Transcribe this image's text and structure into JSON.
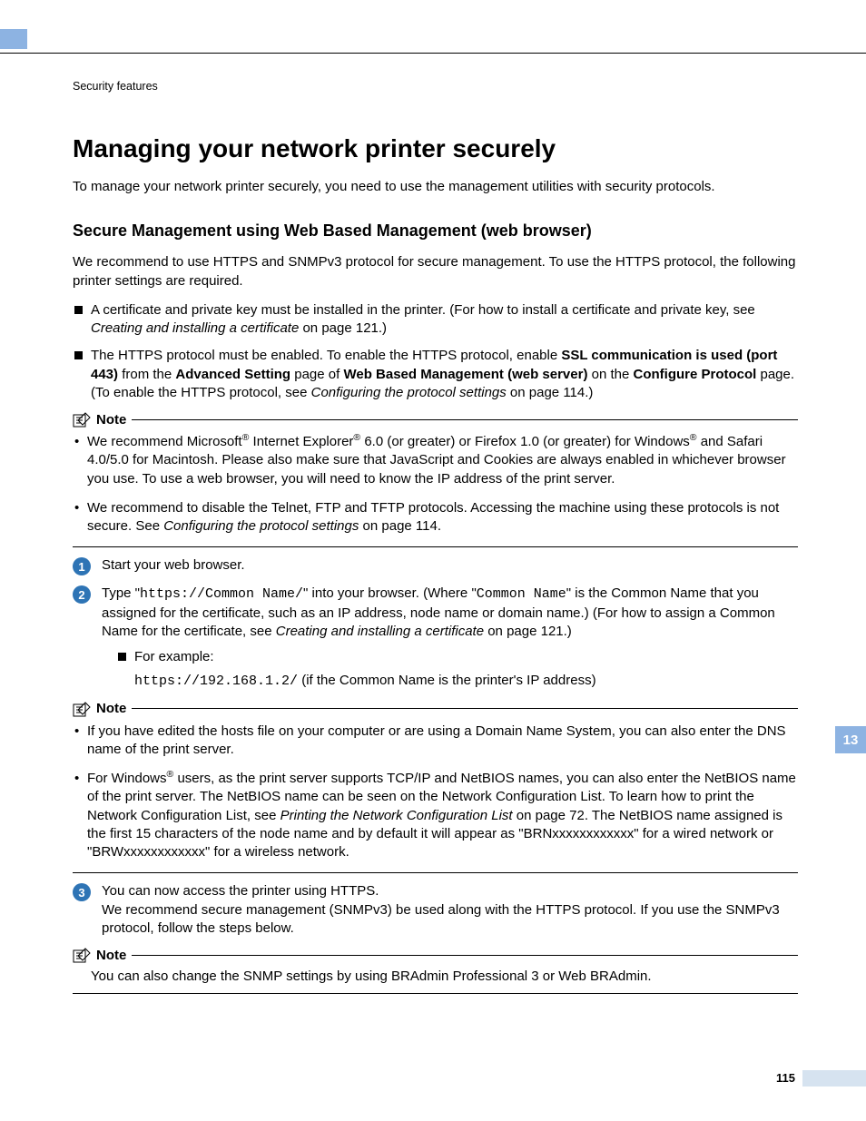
{
  "breadcrumb": "Security features",
  "h1": "Managing your network printer securely",
  "intro": "To manage your network printer securely, you need to use the management utilities with security protocols.",
  "h2": "Secure Management using Web Based Management (web browser)",
  "p1": "We recommend to use HTTPS and SNMPv3 protocol for secure management. To use the HTTPS protocol, the following printer settings are required.",
  "bullet1_a": "A certificate and private key must be installed in the printer. (For how to install a certificate and private key, see ",
  "bullet1_link": "Creating and installing a certificate",
  "bullet1_b": " on page 121.)",
  "bullet2_a": "The HTTPS protocol must be enabled. To enable the HTTPS protocol, enable ",
  "bullet2_b": "SSL communication is used (port 443)",
  "bullet2_c": " from the ",
  "bullet2_d": "Advanced Setting",
  "bullet2_e": " page of ",
  "bullet2_f": "Web Based Management (web server)",
  "bullet2_g": " on the ",
  "bullet2_h": "Configure Protocol",
  "bullet2_i": " page. (To enable the HTTPS protocol, see ",
  "bullet2_link": "Configuring the protocol settings",
  "bullet2_j": " on page 114.)",
  "note_label": "Note",
  "note1_item1_a": "We recommend Microsoft",
  "note1_item1_b": " Internet Explorer",
  "note1_item1_c": " 6.0 (or greater) or Firefox 1.0 (or greater) for Windows",
  "note1_item1_d": " and Safari 4.0/5.0 for Macintosh. Please also make sure that JavaScript and Cookies are always enabled in whichever browser you use. To use a web browser, you will need to know the IP address of the print server.",
  "note1_item2_a": "We recommend to disable the Telnet, FTP and TFTP protocols. Accessing the machine using these protocols is not secure. See ",
  "note1_item2_link": "Configuring the protocol settings",
  "note1_item2_b": " on page 114.",
  "step1": "Start your web browser.",
  "step2_a": "Type \"",
  "step2_code1": "https://Common Name/",
  "step2_b": "\" into your browser. (Where \"",
  "step2_code2": "Common Name",
  "step2_c": "\" is the Common Name that you assigned for the certificate, such as an IP address, node name or domain name.) (For how to assign a Common Name for the certificate, see ",
  "step2_link": "Creating and installing a certificate",
  "step2_d": " on page 121.)",
  "step2_example_label": "For example:",
  "step2_example_code": "https://192.168.1.2/",
  "step2_example_tail": " (if the Common Name is the printer's IP address)",
  "note2_item1": "If you have edited the hosts file on your computer or are using a Domain Name System, you can also enter the DNS name of the print server.",
  "note2_item2_a": "For Windows",
  "note2_item2_b": " users, as the print server supports TCP/IP and NetBIOS names, you can also enter the NetBIOS name of the print server. The NetBIOS name can be seen on the Network Configuration List. To learn how to print the Network Configuration List, see ",
  "note2_item2_link": "Printing the Network Configuration List",
  "note2_item2_c": " on page 72. The NetBIOS name assigned is the first 15 characters of the node name and by default it will appear as \"BRNxxxxxxxxxxxx\" for a wired network or \"BRWxxxxxxxxxxxx\" for a wireless network.",
  "step3_a": "You can now access the printer using HTTPS.",
  "step3_b": "We recommend secure management (SNMPv3) be used along with the HTTPS protocol. If you use the SNMPv3 protocol, follow the steps below.",
  "note3_text": "You can also change the SNMP settings by using BRAdmin Professional 3 or Web BRAdmin.",
  "side_tab": "13",
  "page_number": "115",
  "reg": "®"
}
